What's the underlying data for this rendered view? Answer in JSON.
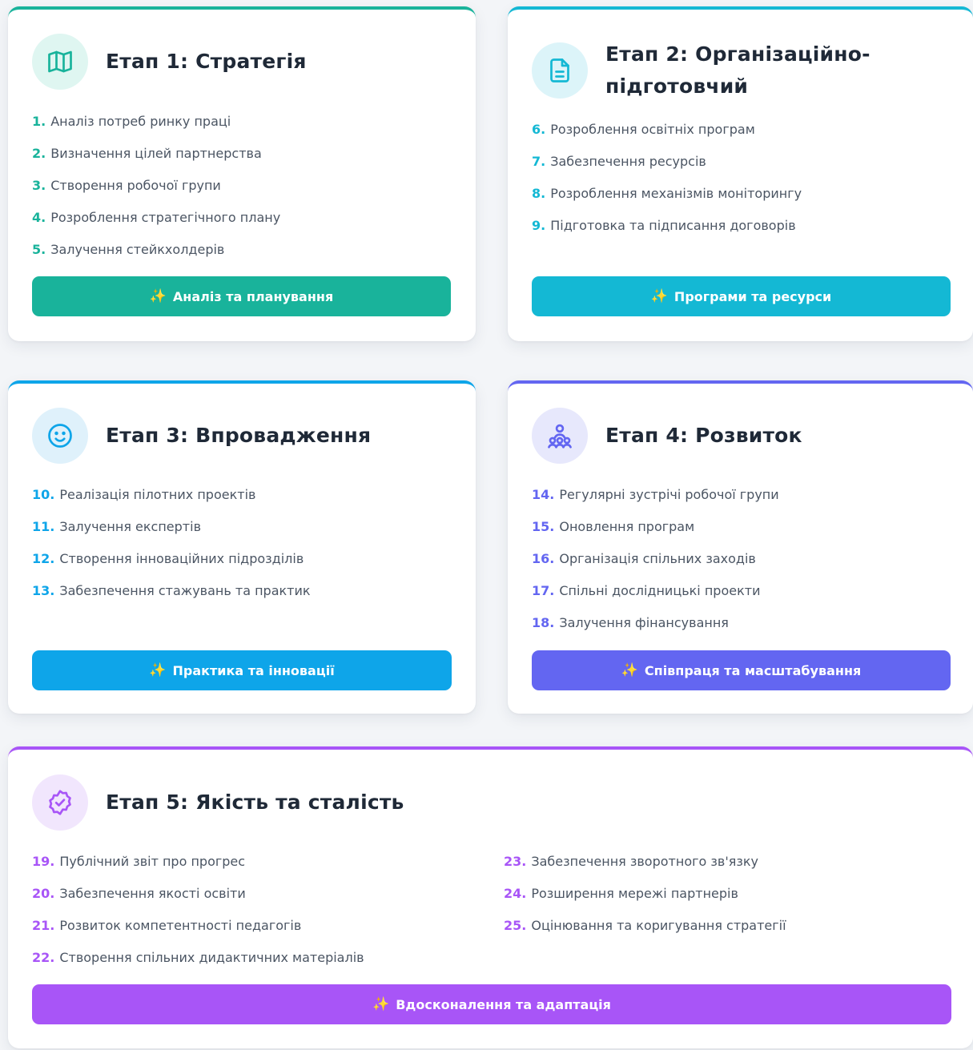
{
  "stages": [
    {
      "title": "Етап 1: Стратегія",
      "icon": "map-icon",
      "accent": "#19b39b",
      "accent_soft": "#dff6f1",
      "steps": [
        {
          "num": "1.",
          "text": "Аналіз потреб ринку праці"
        },
        {
          "num": "2.",
          "text": "Визначення цілей партнерства"
        },
        {
          "num": "3.",
          "text": "Створення робочої групи"
        },
        {
          "num": "4.",
          "text": "Розроблення стратегічного плану"
        },
        {
          "num": "5.",
          "text": "Залучення стейкхолдерів"
        }
      ],
      "button": "Аналіз та планування"
    },
    {
      "title_line1": "Етап 2: Організаційно-",
      "title_line2": "підготовчий",
      "icon": "document-icon",
      "accent": "#14b8d4",
      "accent_soft": "#dcf4f9",
      "steps": [
        {
          "num": "6.",
          "text": "Розроблення освітніх програм"
        },
        {
          "num": "7.",
          "text": "Забезпечення ресурсів"
        },
        {
          "num": "8.",
          "text": "Розроблення механізмів моніторингу"
        },
        {
          "num": "9.",
          "text": "Підготовка та підписання договорів"
        }
      ],
      "button": "Програми та ресурси"
    },
    {
      "title": "Етап 3: Впровадження",
      "icon": "smile-icon",
      "accent": "#0ea5e9",
      "accent_soft": "#dff1fb",
      "steps": [
        {
          "num": "10.",
          "text": "Реалізація пілотних проектів"
        },
        {
          "num": "11.",
          "text": "Залучення експертів"
        },
        {
          "num": "12.",
          "text": "Створення інноваційних підрозділів"
        },
        {
          "num": "13.",
          "text": "Забезпечення стажувань та практик"
        }
      ],
      "button": "Практика та інновації"
    },
    {
      "title": "Етап 4: Розвиток",
      "icon": "team-icon",
      "accent": "#6366f1",
      "accent_soft": "#e7e8fc",
      "steps": [
        {
          "num": "14.",
          "text": "Регулярні зустрічі робочої групи"
        },
        {
          "num": "15.",
          "text": "Оновлення програм"
        },
        {
          "num": "16.",
          "text": "Організація спільних заходів"
        },
        {
          "num": "17.",
          "text": "Спільні дослідницькі проекти"
        },
        {
          "num": "18.",
          "text": "Залучення фінансування"
        }
      ],
      "button": "Співпраця та масштабування"
    },
    {
      "title": "Етап 5: Якість та сталість",
      "icon": "badge-check-icon",
      "accent": "#a855f7",
      "accent_soft": "#f1e6fd",
      "steps": [
        {
          "num": "19.",
          "text": "Публічний звіт про прогрес"
        },
        {
          "num": "20.",
          "text": "Забезпечення якості освіти"
        },
        {
          "num": "21.",
          "text": "Розвиток компетентності педагогів"
        },
        {
          "num": "22.",
          "text": "Створення спільних дидактичних матеріалів"
        },
        {
          "num": "23.",
          "text": "Забезпечення зворотного зв'язку"
        },
        {
          "num": "24.",
          "text": "Розширення мережі партнерів"
        },
        {
          "num": "25.",
          "text": "Оцінювання та коригування стратегії"
        }
      ],
      "button": "Вдосконалення та адаптація"
    }
  ],
  "button_icon": "sparkle-icon",
  "button_glyph": "✨"
}
